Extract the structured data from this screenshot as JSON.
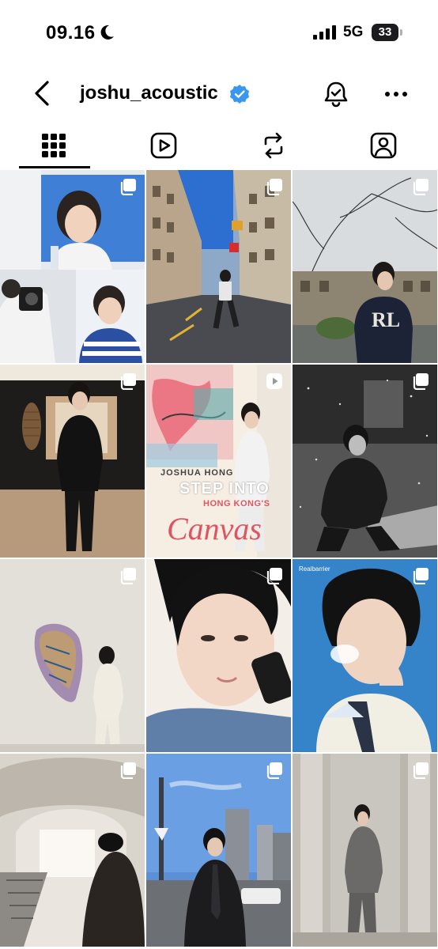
{
  "status_bar": {
    "time": "09.16",
    "network": "5G",
    "battery": "33"
  },
  "header": {
    "username": "joshu_acoustic"
  },
  "tabs": [
    {
      "name": "posts",
      "icon": "grid-icon",
      "active": true
    },
    {
      "name": "reels",
      "icon": "reels-icon",
      "active": false
    },
    {
      "name": "reposts",
      "icon": "repost-icon",
      "active": false
    },
    {
      "name": "tagged",
      "icon": "tagged-icon",
      "active": false
    }
  ],
  "posts": [
    {
      "type": "carousel"
    },
    {
      "type": "carousel"
    },
    {
      "type": "carousel"
    },
    {
      "type": "carousel"
    },
    {
      "type": "reel",
      "overlay": {
        "line1": "JOSHUA HONG",
        "line2": "STEP INTO",
        "line3": "HONG KONG'S",
        "line4": "Canvas"
      }
    },
    {
      "type": "carousel"
    },
    {
      "type": "carousel"
    },
    {
      "type": "carousel"
    },
    {
      "type": "carousel",
      "overlay": {
        "brand": "Realbarrier"
      }
    },
    {
      "type": "carousel"
    },
    {
      "type": "carousel"
    },
    {
      "type": "carousel"
    }
  ],
  "colors": {
    "verified": "#3897f0",
    "text": "#000000"
  }
}
